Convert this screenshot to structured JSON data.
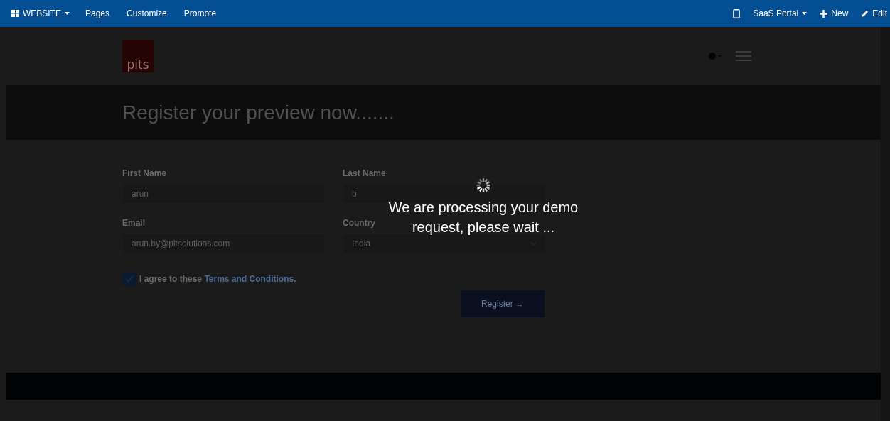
{
  "top_bar": {
    "app_menu": "WEBSITE",
    "menu_items": [
      "Pages",
      "Customize",
      "Promote"
    ],
    "portal": "SaaS Portal",
    "new": "New",
    "edit": "Edit"
  },
  "header": {
    "logo": "pits"
  },
  "banner": {
    "title": "Register your preview now......."
  },
  "form": {
    "fields": [
      {
        "label": "First Name",
        "value": "arun",
        "kind": "text"
      },
      {
        "label": "Last Name",
        "value": "b",
        "kind": "text"
      },
      {
        "label": "Email",
        "value": "arun.by@pitsolutions.com",
        "kind": "text"
      },
      {
        "label": "Country",
        "value": "India",
        "kind": "select"
      }
    ],
    "agree": {
      "checked": true,
      "text": "I agree to these",
      "link": "Terms and Conditions."
    },
    "submit": "Register →"
  },
  "overlay": {
    "message": "We are processing your demo request, please wait ..."
  }
}
